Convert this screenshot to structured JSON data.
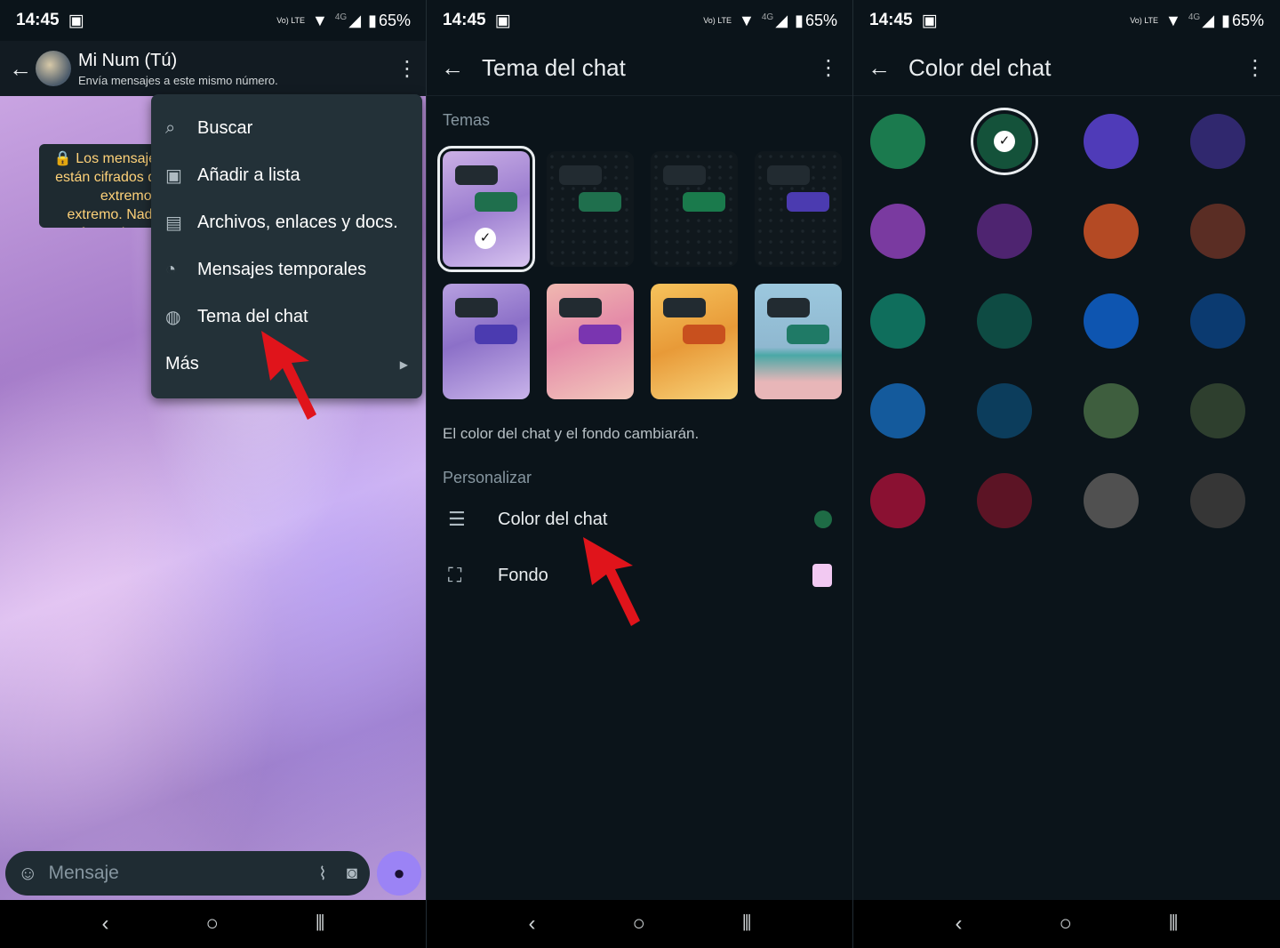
{
  "status": {
    "time": "14:45",
    "battery": "65%",
    "net_tag": "Vo) LTE",
    "net_4g": "4G"
  },
  "panel1": {
    "contact_name": "Mi Num (Tú)",
    "contact_sub": "Envía mensajes a este mismo número.",
    "encryption_notice": "🔒 Los mensajes están cifrados de extremo a extremo. Nadie fuera de este chat, ni siquiera WhatsApp, puede leerlos ni compartirlos.",
    "menu": [
      {
        "label": "Buscar",
        "icon": "search-icon"
      },
      {
        "label": "Añadir a lista",
        "icon": "contact-list-icon"
      },
      {
        "label": "Archivos, enlaces y docs.",
        "icon": "media-icon"
      },
      {
        "label": "Mensajes temporales",
        "icon": "timer-icon"
      },
      {
        "label": "Tema del chat",
        "icon": "palette-icon"
      }
    ],
    "menu_more": "Más",
    "composer_placeholder": "Mensaje"
  },
  "panel2": {
    "title": "Tema del chat",
    "themes_heading": "Temas",
    "themes": [
      {
        "bg": "lilac",
        "bubble": "#1f6f4d",
        "selected": true
      },
      {
        "bg": "dark",
        "bubble": "#1f6f4d",
        "selected": false
      },
      {
        "bg": "dark",
        "bubble": "#1a7a4c",
        "selected": false
      },
      {
        "bg": "dark",
        "bubble": "#4b3bb0",
        "selected": false
      },
      {
        "bg": "purple-silk",
        "bubble": "#4b3bb0",
        "selected": false
      },
      {
        "bg": "pink-flower",
        "bubble": "#7a35b0",
        "selected": false
      },
      {
        "bg": "orange-silk",
        "bubble": "#c8501e",
        "selected": false
      },
      {
        "bg": "beach",
        "bubble": "#1f7a66",
        "selected": false
      }
    ],
    "description": "El color del chat y el fondo cambiarán.",
    "customize_heading": "Personalizar",
    "rows": [
      {
        "label": "Color del chat",
        "icon": "chat-color-icon",
        "swatch": "#1e6b45"
      },
      {
        "label": "Fondo",
        "icon": "wallpaper-icon",
        "swatch": "#f2c9f2"
      }
    ]
  },
  "panel3": {
    "title": "Color del chat",
    "colors": [
      "#1b7a4e",
      "#14523a",
      "#4f3bb8",
      "#30286e",
      "#7a3aa0",
      "#4e2470",
      "#b44a24",
      "#5a2d24",
      "#0f6e5c",
      "#0e4b43",
      "#0e55b0",
      "#0b3a70",
      "#145a9c",
      "#0c3d5c",
      "#3e5e3e",
      "#2e3f2e",
      "#8a1132",
      "#5c1425",
      "#505050",
      "#363636"
    ],
    "selected_index": 1
  }
}
